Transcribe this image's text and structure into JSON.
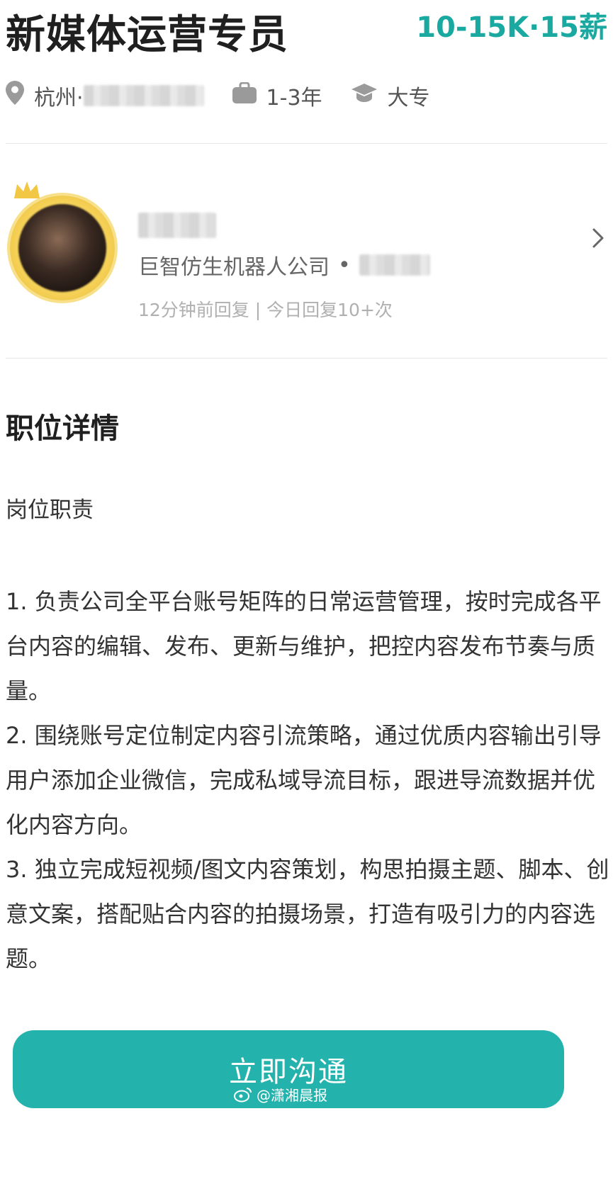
{
  "job": {
    "title": "新媒体运营专员",
    "salary": "10-15K·15薪"
  },
  "meta": {
    "city": "杭州·",
    "experience": "1-3年",
    "education": "大专"
  },
  "recruiter": {
    "company": "巨智仿生机器人公司",
    "separator": "•",
    "reply_status": "12分钟前回复 | 今日回复10+次"
  },
  "details": {
    "section_title": "职位详情",
    "subtitle": "岗位职责",
    "paragraphs": [
      "1. 负责公司全平台账号矩阵的日常运营管理，按时完成各平台内容的编辑、发布、更新与维护，把控内容发布节奏与质量。",
      "2. 围绕账号定位制定内容引流策略，通过优质内容输出引导用户添加企业微信，完成私域导流目标，跟进导流数据并优化内容方向。",
      "3. 独立完成短视频/图文内容策划，构思拍摄主题、脚本、创意文案，搭配贴合内容的拍摄场景，打造有吸引力的内容选题。"
    ]
  },
  "actions": {
    "chat_button": "立即沟通"
  },
  "watermark": "@潇湘晨报",
  "colors": {
    "accent": "#1aa9a0",
    "button": "#23b3ac"
  }
}
